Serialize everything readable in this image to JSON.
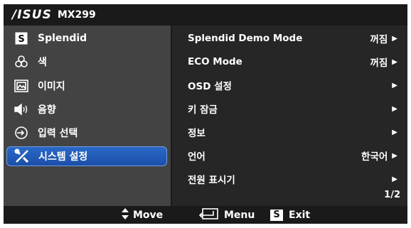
{
  "header": {
    "brand": "/ISUS",
    "model": "MX299"
  },
  "sidebar": {
    "items": [
      {
        "label": "Splendid",
        "icon": "splendid-s-icon"
      },
      {
        "label": "색",
        "icon": "color-icon"
      },
      {
        "label": "이미지",
        "icon": "image-icon"
      },
      {
        "label": "음향",
        "icon": "speaker-icon"
      },
      {
        "label": "입력 선택",
        "icon": "input-select-icon"
      },
      {
        "label": "시스템 설정",
        "icon": "tools-icon",
        "selected": true
      }
    ]
  },
  "main": {
    "items": [
      {
        "label": "Splendid Demo Mode",
        "value": "꺼짐"
      },
      {
        "label": "ECO Mode",
        "value": "꺼짐"
      },
      {
        "label": "OSD 설정",
        "value": ""
      },
      {
        "label": "키 잠금",
        "value": ""
      },
      {
        "label": "정보",
        "value": ""
      },
      {
        "label": "언어",
        "value": "한국어"
      },
      {
        "label": "전원 표시기",
        "value": ""
      }
    ],
    "page": "1/2"
  },
  "footer": {
    "move_label": "Move",
    "menu_label": "Menu",
    "exit_label": "Exit",
    "exit_key": "S"
  },
  "colors": {
    "selected": "#2a68c8",
    "sidebar_bg": "#434343",
    "main_bg": "#262626",
    "bar_bg": "#1a1a1a"
  }
}
